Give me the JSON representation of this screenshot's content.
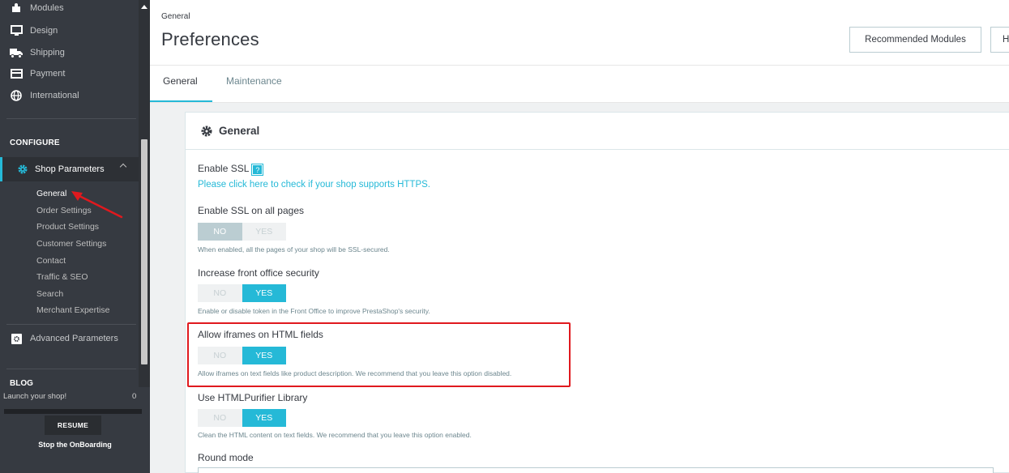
{
  "sidebar": {
    "items_top": [
      {
        "label": "Modules",
        "icon": "puzzle-icon"
      },
      {
        "label": "Design",
        "icon": "monitor-icon"
      },
      {
        "label": "Shipping",
        "icon": "truck-icon"
      },
      {
        "label": "Payment",
        "icon": "credit-card-icon"
      },
      {
        "label": "International",
        "icon": "globe-icon"
      }
    ],
    "configure_heading": "CONFIGURE",
    "shop_parameters": {
      "label": "Shop Parameters",
      "icon": "gear-icon",
      "subitems": [
        "General",
        "Order Settings",
        "Product Settings",
        "Customer Settings",
        "Contact",
        "Traffic & SEO",
        "Search",
        "Merchant Expertise"
      ]
    },
    "advanced_parameters": {
      "label": "Advanced Parameters",
      "icon": "cog-box-icon"
    },
    "blog_heading": "BLOG",
    "onboarding": {
      "launch_text": "Launch your shop!",
      "percent": "0",
      "progress": 0.0,
      "resume_label": "RESUME",
      "stop_label": "Stop the OnBoarding"
    }
  },
  "header": {
    "breadcrumb": "General",
    "title": "Preferences",
    "recommended_modules_label": "Recommended Modules",
    "help_label": "H"
  },
  "tabs": [
    {
      "label": "General",
      "active": true
    },
    {
      "label": "Maintenance",
      "active": false
    }
  ],
  "panel": {
    "title": "General",
    "enable_ssl": {
      "label": "Enable SSL",
      "help": "?",
      "link": "Please click here to check if your shop supports HTTPS."
    },
    "fields": [
      {
        "label": "Enable SSL on all pages",
        "no": "NO",
        "yes": "YES",
        "value": "NO",
        "hint": "When enabled, all the pages of your shop will be SSL-secured."
      },
      {
        "label": "Increase front office security",
        "no": "NO",
        "yes": "YES",
        "value": "YES",
        "hint": "Enable or disable token in the Front Office to improve PrestaShop's security."
      },
      {
        "label": "Allow iframes on HTML fields",
        "no": "NO",
        "yes": "YES",
        "value": "YES",
        "hint": "Allow iframes on text fields like product description. We recommend that you leave this option disabled."
      },
      {
        "label": "Use HTMLPurifier Library",
        "no": "NO",
        "yes": "YES",
        "value": "YES",
        "hint": "Clean the HTML content on text fields. We recommend that you leave this option enabled."
      }
    ],
    "round_mode_label": "Round mode"
  },
  "colors": {
    "accent": "#25b9d7",
    "sidebar_bg": "#363a41",
    "highlight": "#e0191e"
  }
}
